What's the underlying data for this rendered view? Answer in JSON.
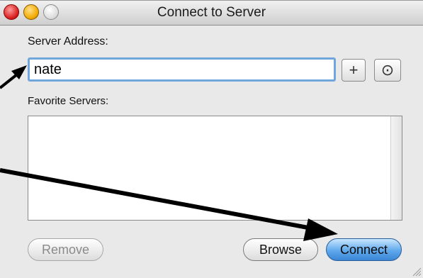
{
  "window": {
    "title": "Connect to Server"
  },
  "server_address": {
    "label": "Server Address:",
    "value": "nate"
  },
  "favorites": {
    "label": "Favorite Servers:"
  },
  "buttons": {
    "add": "+",
    "recent": "⊙",
    "remove": "Remove",
    "browse": "Browse",
    "connect": "Connect"
  },
  "colors": {
    "accent": "#5fa8ec",
    "focus": "#6fa6dc"
  }
}
